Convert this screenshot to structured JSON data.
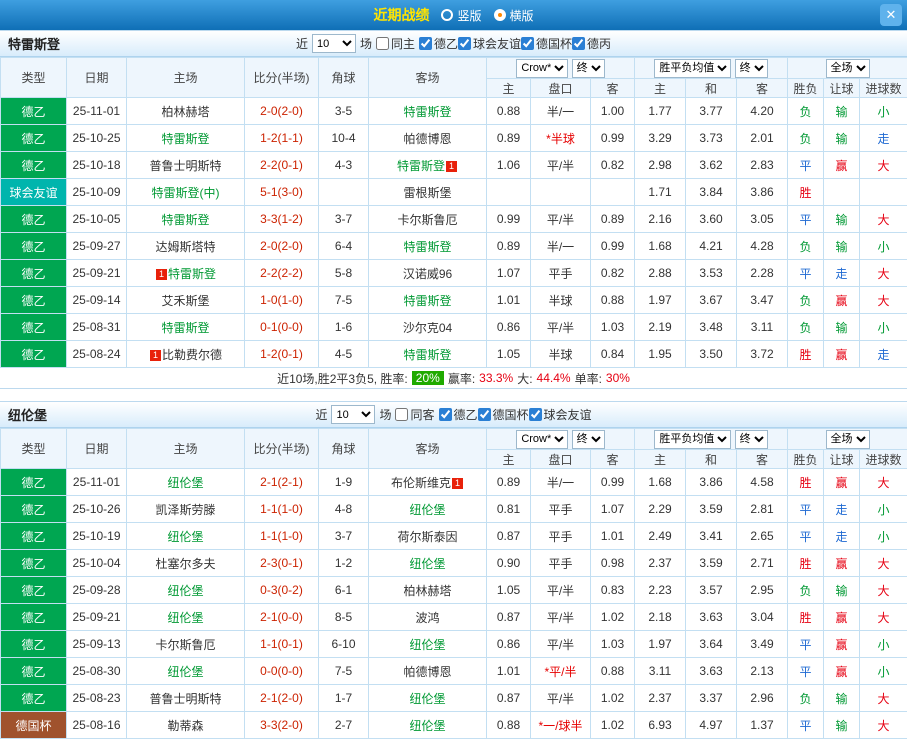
{
  "titlebar": {
    "title": "近期战绩",
    "radio_vertical": "竖版",
    "radio_horizontal": "横版",
    "selected": "横版",
    "close_icon": "✕"
  },
  "table_header": {
    "type": "类型",
    "date": "日期",
    "home": "主场",
    "score": "比分(半场)",
    "corner": "角球",
    "away": "客场",
    "odds_source": "Crow*",
    "final_label": "终",
    "asian_cols": [
      "主",
      "盘口",
      "客"
    ],
    "europe_source": "胜平负均值",
    "europe_cols": [
      "主",
      "和",
      "客"
    ],
    "scope": "全场",
    "result_cols": [
      "胜负",
      "让球",
      "进球数"
    ]
  },
  "type_colors": {
    "德乙": "#00a651",
    "球会友谊": "#00b5ad",
    "德国杯": "#a0522d"
  },
  "result_colors": {
    "red": "#e60012",
    "green": "#009933",
    "blue": "#1e69d2"
  },
  "sections": [
    {
      "team": "特雷斯登",
      "filters": {
        "recent": "近",
        "count": "10",
        "unit": "场",
        "same_venue": "同主",
        "same_venue_checked": false,
        "leagues": [
          {
            "label": "德乙",
            "checked": true
          },
          {
            "label": "球会友谊",
            "checked": true
          },
          {
            "label": "德国杯",
            "checked": true
          },
          {
            "label": "德丙",
            "checked": true
          }
        ]
      },
      "rows": [
        {
          "type": "德乙",
          "date": "25-11-01",
          "home": {
            "name": "柏林赫塔"
          },
          "score": "2-0(2-0)",
          "corner": "3-5",
          "away": {
            "name": "特雷斯登",
            "focus": true
          },
          "asian": [
            "0.88",
            "半/一",
            "1.00"
          ],
          "asian_red": false,
          "europe": [
            "1.77",
            "3.77",
            "4.20"
          ],
          "results": [
            [
              "负",
              "green"
            ],
            [
              "输",
              "green"
            ],
            [
              "小",
              "green"
            ]
          ]
        },
        {
          "type": "德乙",
          "date": "25-10-25",
          "home": {
            "name": "特雷斯登",
            "focus": true
          },
          "score": "1-2(1-1)",
          "corner": "10-4",
          "away": {
            "name": "帕德博恩"
          },
          "asian": [
            "0.89",
            "*半球",
            "0.99"
          ],
          "asian_red": true,
          "europe": [
            "3.29",
            "3.73",
            "2.01"
          ],
          "results": [
            [
              "负",
              "green"
            ],
            [
              "输",
              "green"
            ],
            [
              "走",
              "blue"
            ]
          ]
        },
        {
          "type": "德乙",
          "date": "25-10-18",
          "home": {
            "name": "普鲁士明斯特"
          },
          "score": "2-2(0-1)",
          "corner": "4-3",
          "away": {
            "name": "特雷斯登",
            "focus": true,
            "badge": "1",
            "badge_pos": "after"
          },
          "asian": [
            "1.06",
            "平/半",
            "0.82"
          ],
          "asian_red": false,
          "europe": [
            "2.98",
            "3.62",
            "2.83"
          ],
          "results": [
            [
              "平",
              "blue"
            ],
            [
              "赢",
              "red"
            ],
            [
              "大",
              "red"
            ]
          ]
        },
        {
          "type": "球会友谊",
          "date": "25-10-09",
          "home": {
            "name": "特雷斯登(中)",
            "focus": true
          },
          "score": "5-1(3-0)",
          "corner": "",
          "away": {
            "name": "雷根斯堡"
          },
          "asian": [
            "",
            "",
            ""
          ],
          "asian_red": false,
          "europe": [
            "1.71",
            "3.84",
            "3.86"
          ],
          "results": [
            [
              "胜",
              "red"
            ],
            [
              "",
              ""
            ],
            [
              "",
              ""
            ]
          ]
        },
        {
          "type": "德乙",
          "date": "25-10-05",
          "home": {
            "name": "特雷斯登",
            "focus": true
          },
          "score": "3-3(1-2)",
          "corner": "3-7",
          "away": {
            "name": "卡尔斯鲁厄"
          },
          "asian": [
            "0.99",
            "平/半",
            "0.89"
          ],
          "asian_red": false,
          "europe": [
            "2.16",
            "3.60",
            "3.05"
          ],
          "results": [
            [
              "平",
              "blue"
            ],
            [
              "输",
              "green"
            ],
            [
              "大",
              "red"
            ]
          ]
        },
        {
          "type": "德乙",
          "date": "25-09-27",
          "home": {
            "name": "达姆斯塔特"
          },
          "score": "2-0(2-0)",
          "corner": "6-4",
          "away": {
            "name": "特雷斯登",
            "focus": true
          },
          "asian": [
            "0.89",
            "半/一",
            "0.99"
          ],
          "asian_red": false,
          "europe": [
            "1.68",
            "4.21",
            "4.28"
          ],
          "results": [
            [
              "负",
              "green"
            ],
            [
              "输",
              "green"
            ],
            [
              "小",
              "green"
            ]
          ]
        },
        {
          "type": "德乙",
          "date": "25-09-21",
          "home": {
            "name": "特雷斯登",
            "focus": true,
            "badge": "1",
            "badge_pos": "before"
          },
          "score": "2-2(2-2)",
          "corner": "5-8",
          "away": {
            "name": "汉诺威96"
          },
          "asian": [
            "1.07",
            "平手",
            "0.82"
          ],
          "asian_red": false,
          "europe": [
            "2.88",
            "3.53",
            "2.28"
          ],
          "results": [
            [
              "平",
              "blue"
            ],
            [
              "走",
              "blue"
            ],
            [
              "大",
              "red"
            ]
          ]
        },
        {
          "type": "德乙",
          "date": "25-09-14",
          "home": {
            "name": "艾禾斯堡"
          },
          "score": "1-0(1-0)",
          "corner": "7-5",
          "away": {
            "name": "特雷斯登",
            "focus": true
          },
          "asian": [
            "1.01",
            "半球",
            "0.88"
          ],
          "asian_red": false,
          "europe": [
            "1.97",
            "3.67",
            "3.47"
          ],
          "results": [
            [
              "负",
              "green"
            ],
            [
              "赢",
              "red"
            ],
            [
              "大",
              "red"
            ]
          ]
        },
        {
          "type": "德乙",
          "date": "25-08-31",
          "home": {
            "name": "特雷斯登",
            "focus": true
          },
          "score": "0-1(0-0)",
          "corner": "1-6",
          "away": {
            "name": "沙尔克04"
          },
          "asian": [
            "0.86",
            "平/半",
            "1.03"
          ],
          "asian_red": false,
          "europe": [
            "2.19",
            "3.48",
            "3.11"
          ],
          "results": [
            [
              "负",
              "green"
            ],
            [
              "输",
              "green"
            ],
            [
              "小",
              "green"
            ]
          ]
        },
        {
          "type": "德乙",
          "date": "25-08-24",
          "home": {
            "name": "比勒费尔德",
            "badge": "1",
            "badge_pos": "before"
          },
          "score": "1-2(0-1)",
          "corner": "4-5",
          "away": {
            "name": "特雷斯登",
            "focus": true
          },
          "asian": [
            "1.05",
            "半球",
            "0.84"
          ],
          "asian_red": false,
          "europe": [
            "1.95",
            "3.50",
            "3.72"
          ],
          "results": [
            [
              "胜",
              "red"
            ],
            [
              "赢",
              "red"
            ],
            [
              "走",
              "blue"
            ]
          ]
        }
      ],
      "summary": {
        "prefix": "近10场,胜2平3负5, 胜率:",
        "win_rate": "20%",
        "handicap_label": "赢率:",
        "handicap_value": "33.3%",
        "big_label": "大:",
        "big_value": "44.4%",
        "odd_label": "单率:",
        "odd_value": "30%"
      }
    },
    {
      "team": "纽伦堡",
      "filters": {
        "recent": "近",
        "count": "10",
        "unit": "场",
        "same_venue": "同客",
        "same_venue_checked": false,
        "leagues": [
          {
            "label": "德乙",
            "checked": true
          },
          {
            "label": "德国杯",
            "checked": true
          },
          {
            "label": "球会友谊",
            "checked": true
          }
        ]
      },
      "rows": [
        {
          "type": "德乙",
          "date": "25-11-01",
          "home": {
            "name": "纽伦堡",
            "focus": true
          },
          "score": "2-1(2-1)",
          "corner": "1-9",
          "away": {
            "name": "布伦斯维克",
            "badge": "1",
            "badge_pos": "after"
          },
          "asian": [
            "0.89",
            "半/一",
            "0.99"
          ],
          "asian_red": false,
          "europe": [
            "1.68",
            "3.86",
            "4.58"
          ],
          "results": [
            [
              "胜",
              "red"
            ],
            [
              "赢",
              "red"
            ],
            [
              "大",
              "red"
            ]
          ]
        },
        {
          "type": "德乙",
          "date": "25-10-26",
          "home": {
            "name": "凯泽斯劳滕"
          },
          "score": "1-1(1-0)",
          "corner": "4-8",
          "away": {
            "name": "纽伦堡",
            "focus": true
          },
          "asian": [
            "0.81",
            "平手",
            "1.07"
          ],
          "asian_red": false,
          "europe": [
            "2.29",
            "3.59",
            "2.81"
          ],
          "results": [
            [
              "平",
              "blue"
            ],
            [
              "走",
              "blue"
            ],
            [
              "小",
              "green"
            ]
          ]
        },
        {
          "type": "德乙",
          "date": "25-10-19",
          "home": {
            "name": "纽伦堡",
            "focus": true
          },
          "score": "1-1(1-0)",
          "corner": "3-7",
          "away": {
            "name": "荷尔斯泰因"
          },
          "asian": [
            "0.87",
            "平手",
            "1.01"
          ],
          "asian_red": false,
          "europe": [
            "2.49",
            "3.41",
            "2.65"
          ],
          "results": [
            [
              "平",
              "blue"
            ],
            [
              "走",
              "blue"
            ],
            [
              "小",
              "green"
            ]
          ]
        },
        {
          "type": "德乙",
          "date": "25-10-04",
          "home": {
            "name": "杜塞尔多夫"
          },
          "score": "2-3(0-1)",
          "corner": "1-2",
          "away": {
            "name": "纽伦堡",
            "focus": true
          },
          "asian": [
            "0.90",
            "平手",
            "0.98"
          ],
          "asian_red": false,
          "europe": [
            "2.37",
            "3.59",
            "2.71"
          ],
          "results": [
            [
              "胜",
              "red"
            ],
            [
              "赢",
              "red"
            ],
            [
              "大",
              "red"
            ]
          ]
        },
        {
          "type": "德乙",
          "date": "25-09-28",
          "home": {
            "name": "纽伦堡",
            "focus": true
          },
          "score": "0-3(0-2)",
          "corner": "6-1",
          "away": {
            "name": "柏林赫塔"
          },
          "asian": [
            "1.05",
            "平/半",
            "0.83"
          ],
          "asian_red": false,
          "europe": [
            "2.23",
            "3.57",
            "2.95"
          ],
          "results": [
            [
              "负",
              "green"
            ],
            [
              "输",
              "green"
            ],
            [
              "大",
              "red"
            ]
          ]
        },
        {
          "type": "德乙",
          "date": "25-09-21",
          "home": {
            "name": "纽伦堡",
            "focus": true
          },
          "score": "2-1(0-0)",
          "corner": "8-5",
          "away": {
            "name": "波鸿"
          },
          "asian": [
            "0.87",
            "平/半",
            "1.02"
          ],
          "asian_red": false,
          "europe": [
            "2.18",
            "3.63",
            "3.04"
          ],
          "results": [
            [
              "胜",
              "red"
            ],
            [
              "赢",
              "red"
            ],
            [
              "大",
              "red"
            ]
          ]
        },
        {
          "type": "德乙",
          "date": "25-09-13",
          "home": {
            "name": "卡尔斯鲁厄"
          },
          "score": "1-1(0-1)",
          "corner": "6-10",
          "away": {
            "name": "纽伦堡",
            "focus": true
          },
          "asian": [
            "0.86",
            "平/半",
            "1.03"
          ],
          "asian_red": false,
          "europe": [
            "1.97",
            "3.64",
            "3.49"
          ],
          "results": [
            [
              "平",
              "blue"
            ],
            [
              "赢",
              "red"
            ],
            [
              "小",
              "green"
            ]
          ]
        },
        {
          "type": "德乙",
          "date": "25-08-30",
          "home": {
            "name": "纽伦堡",
            "focus": true
          },
          "score": "0-0(0-0)",
          "corner": "7-5",
          "away": {
            "name": "帕德博恩"
          },
          "asian": [
            "1.01",
            "*平/半",
            "0.88"
          ],
          "asian_red": true,
          "europe": [
            "3.11",
            "3.63",
            "2.13"
          ],
          "results": [
            [
              "平",
              "blue"
            ],
            [
              "赢",
              "red"
            ],
            [
              "小",
              "green"
            ]
          ]
        },
        {
          "type": "德乙",
          "date": "25-08-23",
          "home": {
            "name": "普鲁士明斯特"
          },
          "score": "2-1(2-0)",
          "corner": "1-7",
          "away": {
            "name": "纽伦堡",
            "focus": true
          },
          "asian": [
            "0.87",
            "平/半",
            "1.02"
          ],
          "asian_red": false,
          "europe": [
            "2.37",
            "3.37",
            "2.96"
          ],
          "results": [
            [
              "负",
              "green"
            ],
            [
              "输",
              "green"
            ],
            [
              "大",
              "red"
            ]
          ]
        },
        {
          "type": "德国杯",
          "date": "25-08-16",
          "home": {
            "name": "勒蒂森"
          },
          "score": "3-3(2-0)",
          "corner": "2-7",
          "away": {
            "name": "纽伦堡",
            "focus": true
          },
          "asian": [
            "0.88",
            "*一/球半",
            "1.02"
          ],
          "asian_red": true,
          "europe": [
            "6.93",
            "4.97",
            "1.37"
          ],
          "results": [
            [
              "平",
              "blue"
            ],
            [
              "输",
              "green"
            ],
            [
              "大",
              "red"
            ]
          ]
        }
      ]
    }
  ]
}
